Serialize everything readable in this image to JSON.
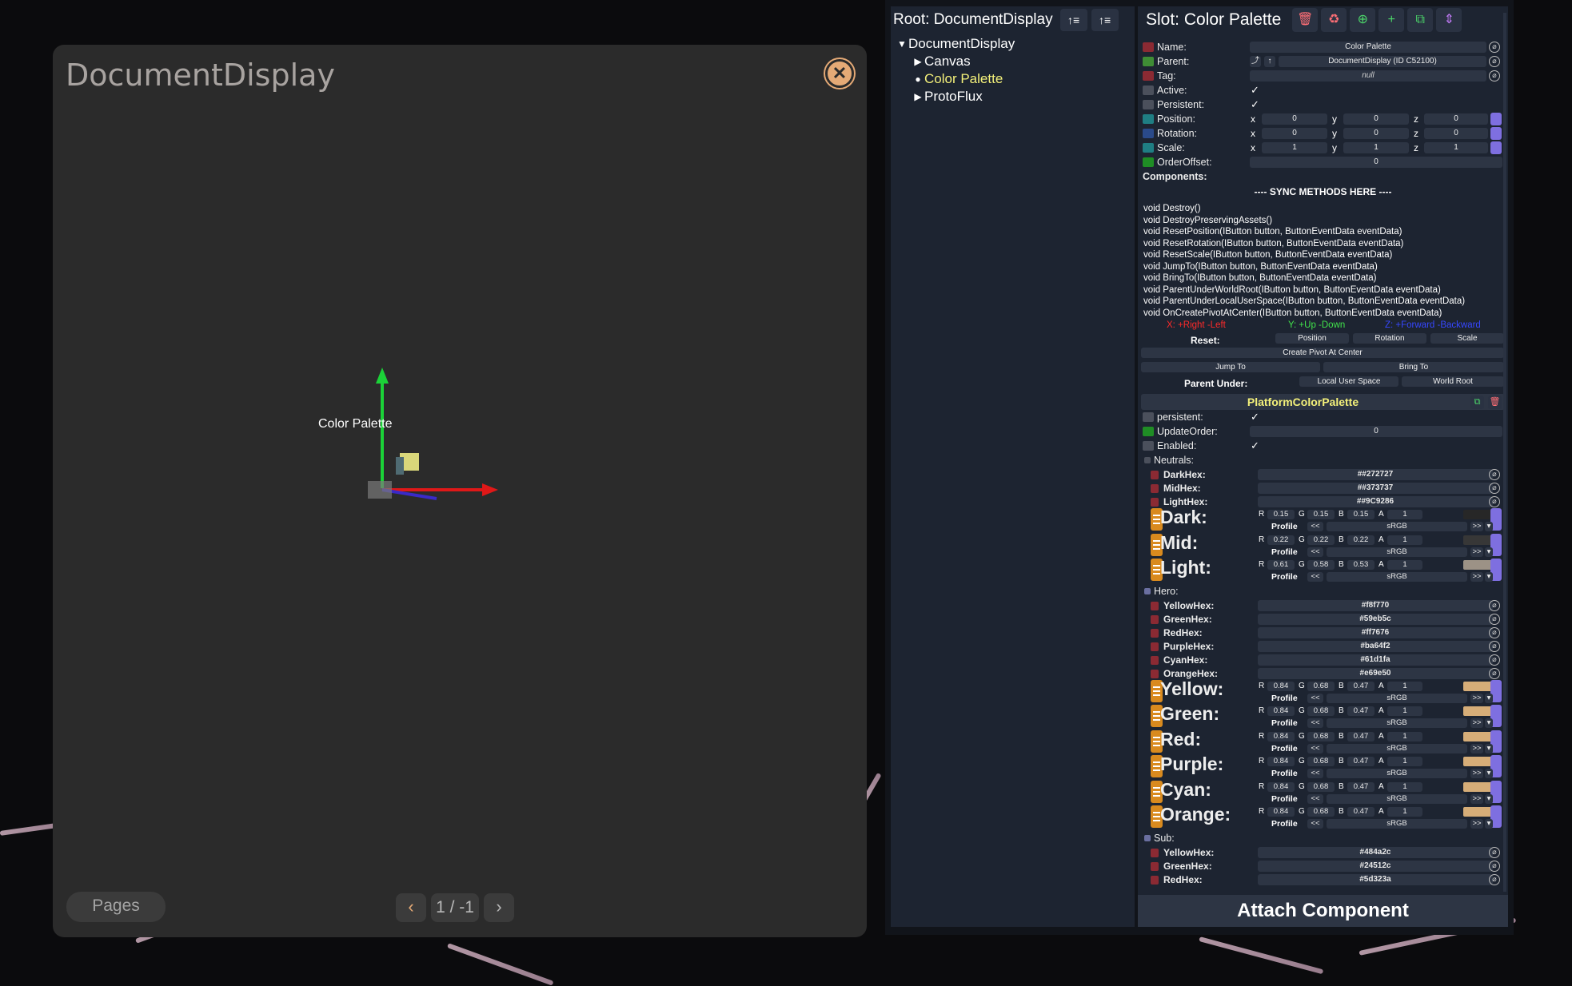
{
  "doc": {
    "title": "DocumentDisplay",
    "close": "✕",
    "gizmo_label": "Color Palette",
    "pages_label": "Pages",
    "prev": "‹",
    "next": "›",
    "page_indicator": "1 / -1"
  },
  "hierarchy": {
    "root_label": "Root: DocumentDisplay",
    "items": [
      {
        "label": "DocumentDisplay",
        "toggle": "▼"
      },
      {
        "label": "Canvas",
        "toggle": "▶"
      },
      {
        "label": "Color Palette",
        "toggle": "●"
      },
      {
        "label": "ProtoFlux",
        "toggle": "▶"
      }
    ]
  },
  "slot": {
    "title": "Slot: Color Palette",
    "name_label": "Name:",
    "name_value": "Color Palette",
    "parent_label": "Parent:",
    "parent_value": "DocumentDisplay (ID C52100)",
    "tag_label": "Tag:",
    "tag_value": "null",
    "active_label": "Active:",
    "persistent_label": "Persistent:",
    "position_label": "Position:",
    "position": [
      "0",
      "0",
      "0"
    ],
    "rotation_label": "Rotation:",
    "rotation": [
      "0",
      "0",
      "0"
    ],
    "scale_label": "Scale:",
    "scale": [
      "1",
      "1",
      "1"
    ],
    "orderoffset_label": "OrderOffset:",
    "orderoffset": "0",
    "components_label": "Components:",
    "axis": [
      "x",
      "y",
      "z"
    ],
    "check": "✓"
  },
  "sync": {
    "header": "---- SYNC METHODS HERE ----",
    "methods": [
      "void Destroy()",
      "void DestroyPreservingAssets()",
      "void ResetPosition(IButton button, ButtonEventData eventData)",
      "void ResetRotation(IButton button, ButtonEventData eventData)",
      "void ResetScale(IButton button, ButtonEventData eventData)",
      "void JumpTo(IButton button, ButtonEventData eventData)",
      "void BringTo(IButton button, ButtonEventData eventData)",
      "void ParentUnderWorldRoot(IButton button, ButtonEventData eventData)",
      "void ParentUnderLocalUserSpace(IButton button, ButtonEventData eventData)",
      "void OnCreatePivotAtCenter(IButton button, ButtonEventData eventData)"
    ],
    "axis_x": "X: +Right -Left",
    "axis_y": "Y: +Up -Down",
    "axis_z": "Z: +Forward -Backward",
    "reset_label": "Reset:",
    "reset_position": "Position",
    "reset_rotation": "Rotation",
    "reset_scale": "Scale",
    "create_pivot": "Create Pivot At Center",
    "jump_to": "Jump To",
    "bring_to": "Bring To",
    "parent_under_label": "Parent Under:",
    "local_user_space": "Local User Space",
    "world_root": "World Root"
  },
  "component": {
    "title": "PlatformColorPalette",
    "persistent_label": "persistent:",
    "updateorder_label": "UpdateOrder:",
    "updateorder": "0",
    "enabled_label": "Enabled:",
    "neutrals_label": "Neutrals:",
    "neutral_hex": [
      {
        "label": "DarkHex:",
        "value": "##272727"
      },
      {
        "label": "MidHex:",
        "value": "##373737"
      },
      {
        "label": "LightHex:",
        "value": "##9C9286"
      }
    ],
    "neutral_colors": [
      {
        "label": "Dark:",
        "r": "0.15",
        "g": "0.15",
        "b": "0.15",
        "a": "1",
        "swatch": "#272727"
      },
      {
        "label": "Mid:",
        "r": "0.22",
        "g": "0.22",
        "b": "0.22",
        "a": "1",
        "swatch": "#373737"
      },
      {
        "label": "Light:",
        "r": "0.61",
        "g": "0.58",
        "b": "0.53",
        "a": "1",
        "swatch": "#9c9286"
      }
    ],
    "hero_label": "Hero:",
    "hero_hex": [
      {
        "label": "YellowHex:",
        "value": "#f8f770"
      },
      {
        "label": "GreenHex:",
        "value": "#59eb5c"
      },
      {
        "label": "RedHex:",
        "value": "#ff7676"
      },
      {
        "label": "PurpleHex:",
        "value": "#ba64f2"
      },
      {
        "label": "CyanHex:",
        "value": "#61d1fa"
      },
      {
        "label": "OrangeHex:",
        "value": "#e69e50"
      }
    ],
    "hero_colors": [
      {
        "label": "Yellow:",
        "r": "0.84",
        "g": "0.68",
        "b": "0.47",
        "a": "1",
        "swatch": "#d6ad78"
      },
      {
        "label": "Green:",
        "r": "0.84",
        "g": "0.68",
        "b": "0.47",
        "a": "1",
        "swatch": "#d6ad78"
      },
      {
        "label": "Red:",
        "r": "0.84",
        "g": "0.68",
        "b": "0.47",
        "a": "1",
        "swatch": "#d6ad78"
      },
      {
        "label": "Purple:",
        "r": "0.84",
        "g": "0.68",
        "b": "0.47",
        "a": "1",
        "swatch": "#d6ad78"
      },
      {
        "label": "Cyan:",
        "r": "0.84",
        "g": "0.68",
        "b": "0.47",
        "a": "1",
        "swatch": "#d6ad78"
      },
      {
        "label": "Orange:",
        "r": "0.84",
        "g": "0.68",
        "b": "0.47",
        "a": "1",
        "swatch": "#d6ad78"
      }
    ],
    "sub_label": "Sub:",
    "sub_hex": [
      {
        "label": "YellowHex:",
        "value": "#484a2c"
      },
      {
        "label": "GreenHex:",
        "value": "#24512c"
      },
      {
        "label": "RedHex:",
        "value": "#5d323a"
      }
    ],
    "channels": [
      "R",
      "G",
      "B",
      "A"
    ],
    "profile_label": "Profile",
    "profile_value": "sRGB",
    "prev": "<<",
    "next": ">>"
  },
  "attach_label": "Attach Component",
  "colors": {
    "accent_yellow": "#f3f07a",
    "panel": "#1d2431",
    "orange": "#e5aa76"
  }
}
